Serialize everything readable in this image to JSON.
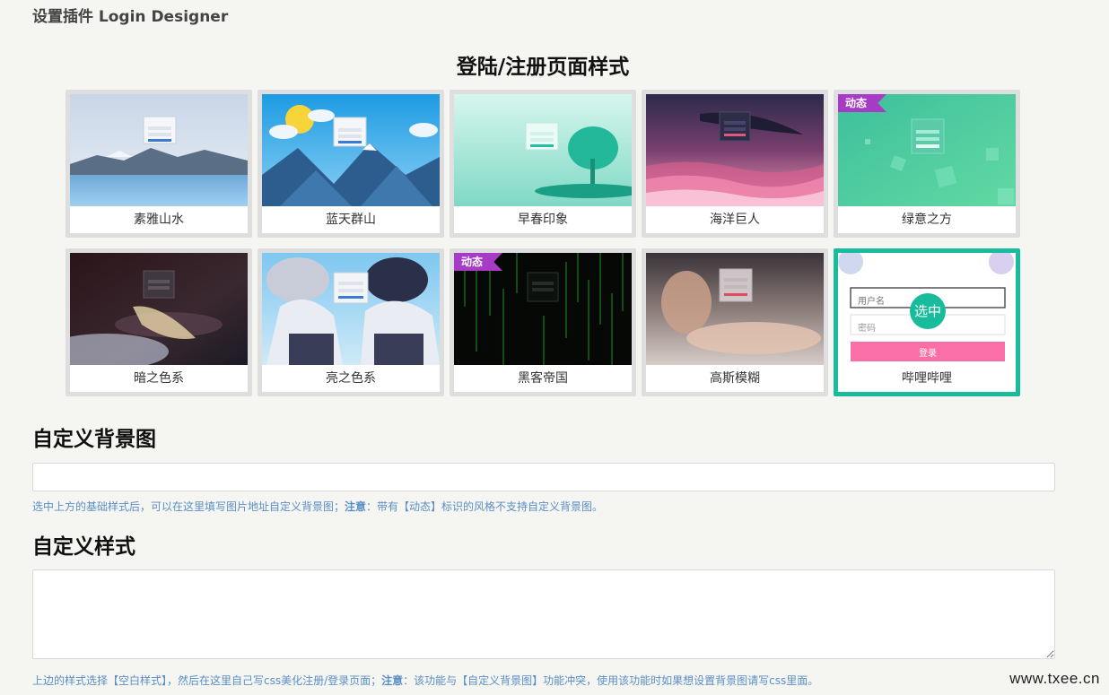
{
  "header": {
    "title": "设置插件 Login Designer"
  },
  "styles_section": {
    "title": "登陆/注册页面样式",
    "badge_label": "动态",
    "selected_label": "选中",
    "cards": [
      {
        "label": "素雅山水",
        "theme": "lake",
        "dynamic": false,
        "selected": false
      },
      {
        "label": "蓝天群山",
        "theme": "sky-mountains",
        "dynamic": false,
        "selected": false
      },
      {
        "label": "早春印象",
        "theme": "spring",
        "dynamic": false,
        "selected": false
      },
      {
        "label": "海洋巨人",
        "theme": "ocean",
        "dynamic": false,
        "selected": false
      },
      {
        "label": "绿意之方",
        "theme": "green-squares",
        "dynamic": true,
        "selected": false
      },
      {
        "label": "暗之色系",
        "theme": "dark-anime",
        "dynamic": false,
        "selected": false
      },
      {
        "label": "亮之色系",
        "theme": "bright-anime",
        "dynamic": false,
        "selected": false
      },
      {
        "label": "黑客帝国",
        "theme": "matrix",
        "dynamic": true,
        "selected": false
      },
      {
        "label": "高斯模糊",
        "theme": "blur",
        "dynamic": false,
        "selected": false
      },
      {
        "label": "哔哩哔哩",
        "theme": "bilibili",
        "dynamic": false,
        "selected": true
      }
    ],
    "bilibili_preview": {
      "username_placeholder": "用户名",
      "password_placeholder": "密码",
      "login_button": "登录"
    }
  },
  "background_field": {
    "title": "自定义背景图",
    "value": "",
    "hint_prefix": "选中上方的基础样式后，可以在这里填写图片地址自定义背景图；",
    "hint_note": "注意",
    "hint_suffix": "：带有【动态】标识的风格不支持自定义背景图。"
  },
  "css_field": {
    "title": "自定义样式",
    "value": "",
    "hint_prefix": "上边的样式选择【空白样式】，然后在这里自己写css美化注册/登录页面；",
    "hint_note": "注意",
    "hint_suffix": "：该功能与【自定义背景图】功能冲突，使用该功能时如果想设置背景图请写css里面。"
  },
  "watermark": "www.txee.cn",
  "colors": {
    "accent": "#18bc9c",
    "badge": "#a63cc5",
    "hint": "#5b8fc6",
    "card_border": "#dedede"
  }
}
